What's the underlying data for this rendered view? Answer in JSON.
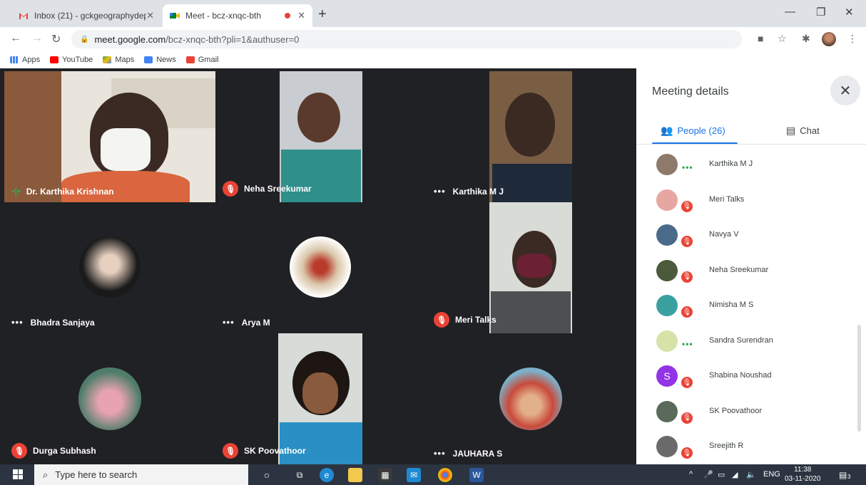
{
  "browser": {
    "tabs": [
      {
        "title": "Inbox (21) - gckgeographydepar"
      },
      {
        "title": "Meet - bcz-xnqc-bth"
      }
    ],
    "url_host": "meet.google.com",
    "url_path": "/bcz-xnqc-bth?pli=1&authuser=0",
    "bookmarks": [
      "Apps",
      "YouTube",
      "Maps",
      "News",
      "Gmail"
    ]
  },
  "participants_grid": [
    {
      "name": "Dr. Karthika Krishnan",
      "status": "speaking"
    },
    {
      "name": "Neha Sreekumar",
      "status": "muted"
    },
    {
      "name": "Karthika M J",
      "status": "more"
    },
    {
      "name": "Bhadra Sanjaya",
      "status": "more"
    },
    {
      "name": "Arya M",
      "status": "more"
    },
    {
      "name": "Meri Talks",
      "status": "muted"
    },
    {
      "name": "Durga Subhash",
      "status": "muted"
    },
    {
      "name": "SK Poovathoor",
      "status": "muted"
    },
    {
      "name": "JAUHARA S",
      "status": "more"
    }
  ],
  "panel": {
    "title": "Meeting details",
    "people_tab": "People (26)",
    "chat_tab": "Chat",
    "people": [
      {
        "name": "Karthika M J",
        "status": "more"
      },
      {
        "name": "Meri Talks",
        "status": "muted"
      },
      {
        "name": "Navya V",
        "status": "muted"
      },
      {
        "name": "Neha Sreekumar",
        "status": "muted"
      },
      {
        "name": "Nimisha M S",
        "status": "muted"
      },
      {
        "name": "Sandra Surendran",
        "status": "more"
      },
      {
        "name": "Shabina Noushad",
        "status": "muted",
        "initial": "S"
      },
      {
        "name": "SK Poovathoor",
        "status": "muted"
      },
      {
        "name": "Sreejith R",
        "status": "muted"
      }
    ]
  },
  "taskbar": {
    "search_placeholder": "Type here to search",
    "lang": "ENG",
    "time": "11:38",
    "date": "03-11-2020",
    "notifications": "3"
  },
  "colors": {
    "muted_red": "#ea4335",
    "accent_blue": "#1a73e8",
    "grid_bg": "#202124"
  }
}
